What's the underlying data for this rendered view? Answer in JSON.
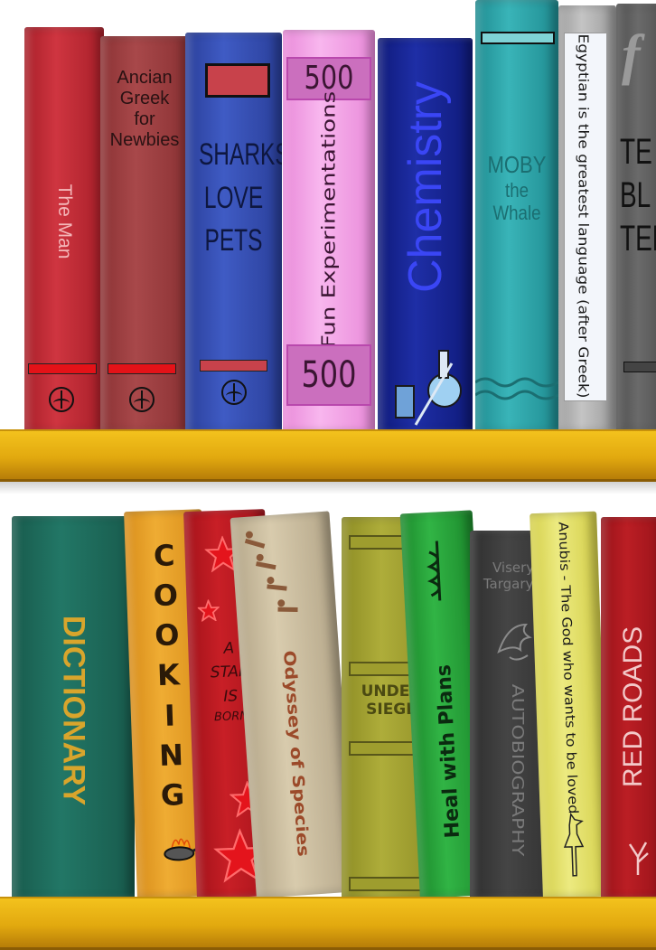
{
  "top_shelf": {
    "books": [
      {
        "title": "The Man"
      },
      {
        "title_lines": [
          "Ancian",
          "Greek",
          "for",
          "Newbies"
        ]
      },
      {
        "title_lines": [
          "SHARKS",
          "LOVE",
          "PETS"
        ]
      },
      {
        "title": "Fun Experimentations",
        "top_number": "500",
        "bottom_number": "500"
      },
      {
        "title": "Chemistry"
      },
      {
        "title_lines": [
          "MOBY",
          "the Whale"
        ]
      },
      {
        "title": "Egyptian is the greatest language (after Greek)"
      },
      {
        "title_lines": [
          "TE",
          "BL",
          "TEM"
        ]
      }
    ]
  },
  "bottom_shelf": {
    "books": [
      {
        "title": "DICTIONARY"
      },
      {
        "title_letters": [
          "C",
          "O",
          "O",
          "K",
          "I",
          "N",
          "G"
        ]
      },
      {
        "title_lines": [
          "A",
          "STAR",
          "IS",
          "BORN"
        ]
      },
      {
        "title": "Odyssey of Species"
      },
      {
        "title_lines": [
          "UNDER",
          "SIEGE"
        ]
      },
      {
        "title": "Heal with Plans"
      },
      {
        "author_lines": [
          "Viserys",
          "Targaryen"
        ],
        "title": "AUTOBIOGRAPHY"
      },
      {
        "title": "Anubis - The God who wants to be loved"
      },
      {
        "title": "RED ROADS"
      }
    ]
  },
  "colors": {
    "shelf": "#e8b21a",
    "book_red": "#c0303a",
    "book_brown": "#9b3e40",
    "book_blue": "#3048a8",
    "book_pink": "#f5a6ea",
    "book_navy": "#1a2a9c",
    "book_teal": "#2fa7ab",
    "dictionary": "#1f6d5c",
    "cooking": "#e6a227",
    "star": "#c41c1c",
    "odyssey": "#cbbd9e",
    "siege": "#9e9d2e",
    "heal": "#27a33a",
    "autobio": "#3b3b3b",
    "anubis": "#e6e26a",
    "red_roads": "#b2181e"
  }
}
